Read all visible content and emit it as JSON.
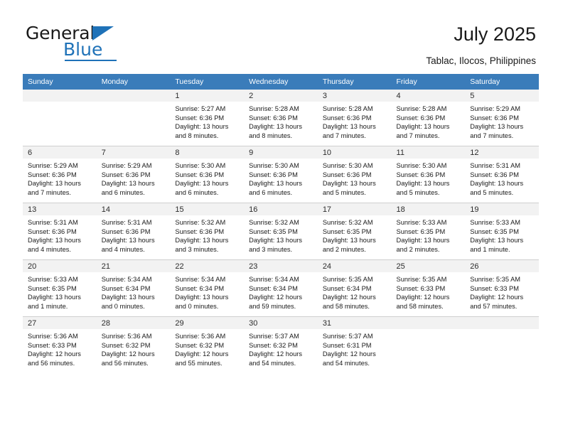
{
  "brand": {
    "name_part1": "General",
    "name_part2": "Blue",
    "accent_color": "#1f72b8"
  },
  "header": {
    "title": "July 2025",
    "subtitle": "Tablac, Ilocos, Philippines",
    "header_bg": "#3a7cba"
  },
  "weekday_headers": [
    "Sunday",
    "Monday",
    "Tuesday",
    "Wednesday",
    "Thursday",
    "Friday",
    "Saturday"
  ],
  "weeks": [
    [
      {
        "day": "",
        "sunrise": "",
        "sunset": "",
        "daylight_line1": "",
        "daylight_line2": ""
      },
      {
        "day": "",
        "sunrise": "",
        "sunset": "",
        "daylight_line1": "",
        "daylight_line2": ""
      },
      {
        "day": "1",
        "sunrise": "Sunrise: 5:27 AM",
        "sunset": "Sunset: 6:36 PM",
        "daylight_line1": "Daylight: 13 hours",
        "daylight_line2": "and 8 minutes."
      },
      {
        "day": "2",
        "sunrise": "Sunrise: 5:28 AM",
        "sunset": "Sunset: 6:36 PM",
        "daylight_line1": "Daylight: 13 hours",
        "daylight_line2": "and 8 minutes."
      },
      {
        "day": "3",
        "sunrise": "Sunrise: 5:28 AM",
        "sunset": "Sunset: 6:36 PM",
        "daylight_line1": "Daylight: 13 hours",
        "daylight_line2": "and 7 minutes."
      },
      {
        "day": "4",
        "sunrise": "Sunrise: 5:28 AM",
        "sunset": "Sunset: 6:36 PM",
        "daylight_line1": "Daylight: 13 hours",
        "daylight_line2": "and 7 minutes."
      },
      {
        "day": "5",
        "sunrise": "Sunrise: 5:29 AM",
        "sunset": "Sunset: 6:36 PM",
        "daylight_line1": "Daylight: 13 hours",
        "daylight_line2": "and 7 minutes."
      }
    ],
    [
      {
        "day": "6",
        "sunrise": "Sunrise: 5:29 AM",
        "sunset": "Sunset: 6:36 PM",
        "daylight_line1": "Daylight: 13 hours",
        "daylight_line2": "and 7 minutes."
      },
      {
        "day": "7",
        "sunrise": "Sunrise: 5:29 AM",
        "sunset": "Sunset: 6:36 PM",
        "daylight_line1": "Daylight: 13 hours",
        "daylight_line2": "and 6 minutes."
      },
      {
        "day": "8",
        "sunrise": "Sunrise: 5:30 AM",
        "sunset": "Sunset: 6:36 PM",
        "daylight_line1": "Daylight: 13 hours",
        "daylight_line2": "and 6 minutes."
      },
      {
        "day": "9",
        "sunrise": "Sunrise: 5:30 AM",
        "sunset": "Sunset: 6:36 PM",
        "daylight_line1": "Daylight: 13 hours",
        "daylight_line2": "and 6 minutes."
      },
      {
        "day": "10",
        "sunrise": "Sunrise: 5:30 AM",
        "sunset": "Sunset: 6:36 PM",
        "daylight_line1": "Daylight: 13 hours",
        "daylight_line2": "and 5 minutes."
      },
      {
        "day": "11",
        "sunrise": "Sunrise: 5:30 AM",
        "sunset": "Sunset: 6:36 PM",
        "daylight_line1": "Daylight: 13 hours",
        "daylight_line2": "and 5 minutes."
      },
      {
        "day": "12",
        "sunrise": "Sunrise: 5:31 AM",
        "sunset": "Sunset: 6:36 PM",
        "daylight_line1": "Daylight: 13 hours",
        "daylight_line2": "and 5 minutes."
      }
    ],
    [
      {
        "day": "13",
        "sunrise": "Sunrise: 5:31 AM",
        "sunset": "Sunset: 6:36 PM",
        "daylight_line1": "Daylight: 13 hours",
        "daylight_line2": "and 4 minutes."
      },
      {
        "day": "14",
        "sunrise": "Sunrise: 5:31 AM",
        "sunset": "Sunset: 6:36 PM",
        "daylight_line1": "Daylight: 13 hours",
        "daylight_line2": "and 4 minutes."
      },
      {
        "day": "15",
        "sunrise": "Sunrise: 5:32 AM",
        "sunset": "Sunset: 6:36 PM",
        "daylight_line1": "Daylight: 13 hours",
        "daylight_line2": "and 3 minutes."
      },
      {
        "day": "16",
        "sunrise": "Sunrise: 5:32 AM",
        "sunset": "Sunset: 6:35 PM",
        "daylight_line1": "Daylight: 13 hours",
        "daylight_line2": "and 3 minutes."
      },
      {
        "day": "17",
        "sunrise": "Sunrise: 5:32 AM",
        "sunset": "Sunset: 6:35 PM",
        "daylight_line1": "Daylight: 13 hours",
        "daylight_line2": "and 2 minutes."
      },
      {
        "day": "18",
        "sunrise": "Sunrise: 5:33 AM",
        "sunset": "Sunset: 6:35 PM",
        "daylight_line1": "Daylight: 13 hours",
        "daylight_line2": "and 2 minutes."
      },
      {
        "day": "19",
        "sunrise": "Sunrise: 5:33 AM",
        "sunset": "Sunset: 6:35 PM",
        "daylight_line1": "Daylight: 13 hours",
        "daylight_line2": "and 1 minute."
      }
    ],
    [
      {
        "day": "20",
        "sunrise": "Sunrise: 5:33 AM",
        "sunset": "Sunset: 6:35 PM",
        "daylight_line1": "Daylight: 13 hours",
        "daylight_line2": "and 1 minute."
      },
      {
        "day": "21",
        "sunrise": "Sunrise: 5:34 AM",
        "sunset": "Sunset: 6:34 PM",
        "daylight_line1": "Daylight: 13 hours",
        "daylight_line2": "and 0 minutes."
      },
      {
        "day": "22",
        "sunrise": "Sunrise: 5:34 AM",
        "sunset": "Sunset: 6:34 PM",
        "daylight_line1": "Daylight: 13 hours",
        "daylight_line2": "and 0 minutes."
      },
      {
        "day": "23",
        "sunrise": "Sunrise: 5:34 AM",
        "sunset": "Sunset: 6:34 PM",
        "daylight_line1": "Daylight: 12 hours",
        "daylight_line2": "and 59 minutes."
      },
      {
        "day": "24",
        "sunrise": "Sunrise: 5:35 AM",
        "sunset": "Sunset: 6:34 PM",
        "daylight_line1": "Daylight: 12 hours",
        "daylight_line2": "and 58 minutes."
      },
      {
        "day": "25",
        "sunrise": "Sunrise: 5:35 AM",
        "sunset": "Sunset: 6:33 PM",
        "daylight_line1": "Daylight: 12 hours",
        "daylight_line2": "and 58 minutes."
      },
      {
        "day": "26",
        "sunrise": "Sunrise: 5:35 AM",
        "sunset": "Sunset: 6:33 PM",
        "daylight_line1": "Daylight: 12 hours",
        "daylight_line2": "and 57 minutes."
      }
    ],
    [
      {
        "day": "27",
        "sunrise": "Sunrise: 5:36 AM",
        "sunset": "Sunset: 6:33 PM",
        "daylight_line1": "Daylight: 12 hours",
        "daylight_line2": "and 56 minutes."
      },
      {
        "day": "28",
        "sunrise": "Sunrise: 5:36 AM",
        "sunset": "Sunset: 6:32 PM",
        "daylight_line1": "Daylight: 12 hours",
        "daylight_line2": "and 56 minutes."
      },
      {
        "day": "29",
        "sunrise": "Sunrise: 5:36 AM",
        "sunset": "Sunset: 6:32 PM",
        "daylight_line1": "Daylight: 12 hours",
        "daylight_line2": "and 55 minutes."
      },
      {
        "day": "30",
        "sunrise": "Sunrise: 5:37 AM",
        "sunset": "Sunset: 6:32 PM",
        "daylight_line1": "Daylight: 12 hours",
        "daylight_line2": "and 54 minutes."
      },
      {
        "day": "31",
        "sunrise": "Sunrise: 5:37 AM",
        "sunset": "Sunset: 6:31 PM",
        "daylight_line1": "Daylight: 12 hours",
        "daylight_line2": "and 54 minutes."
      },
      {
        "day": "",
        "sunrise": "",
        "sunset": "",
        "daylight_line1": "",
        "daylight_line2": ""
      },
      {
        "day": "",
        "sunrise": "",
        "sunset": "",
        "daylight_line1": "",
        "daylight_line2": ""
      }
    ]
  ]
}
